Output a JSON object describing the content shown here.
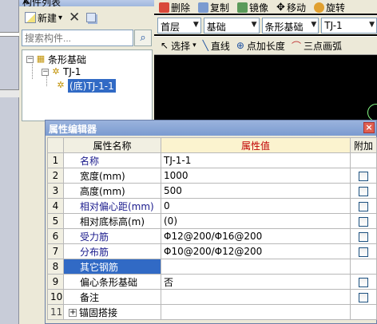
{
  "left_panel": {
    "title": "构件列表",
    "toolbar": {
      "new_label": "新建",
      "new_dropdown": "▾"
    },
    "search": {
      "placeholder": "搜索构件..."
    },
    "tree": {
      "root": "条形基础",
      "child": "TJ-1",
      "leaf": "(底)TJ-1-1"
    }
  },
  "top_toolbar": {
    "delete_label": "删除",
    "copy_label": "复制",
    "mirror_label": "镜像",
    "move_label": "移动",
    "rotate_label": "旋转"
  },
  "filter_bar": {
    "floor": "首层",
    "category": "基础",
    "type": "条形基础",
    "component": "TJ-1"
  },
  "draw_toolbar": {
    "select_label": "选择",
    "line_label": "直线",
    "point_length_label": "点加长度",
    "arc_label": "三点画弧"
  },
  "property_editor": {
    "title": "属性编辑器",
    "close": "×",
    "headers": {
      "name": "属性名称",
      "value": "属性值",
      "extra": "附加"
    },
    "rows": [
      {
        "index": "1",
        "name": "名称",
        "value": "TJ-1-1"
      },
      {
        "index": "2",
        "name": "宽度(mm)",
        "value": "1000"
      },
      {
        "index": "3",
        "name": "高度(mm)",
        "value": "500"
      },
      {
        "index": "4",
        "name": "相对偏心距(mm)",
        "value": "0"
      },
      {
        "index": "5",
        "name": "相对底标高(m)",
        "value": "(0)"
      },
      {
        "index": "6",
        "name": "受力筋",
        "value": "Φ12@200/Φ16@200"
      },
      {
        "index": "7",
        "name": "分布筋",
        "value": "Φ10@200/Φ12@200"
      },
      {
        "index": "8",
        "name": "其它钢筋",
        "value": ""
      },
      {
        "index": "9",
        "name": "偏心条形基础",
        "value": "否"
      },
      {
        "index": "10",
        "name": "备注",
        "value": ""
      },
      {
        "index": "11",
        "name": "锚固搭接",
        "value": ""
      }
    ]
  }
}
